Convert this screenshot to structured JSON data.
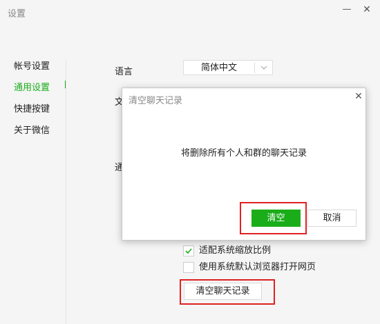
{
  "window": {
    "title": "设置",
    "minimize_glyph": "—",
    "close_glyph": "✕"
  },
  "sidebar": {
    "items": [
      {
        "label": "帐号设置",
        "active": false
      },
      {
        "label": "通用设置",
        "active": true
      },
      {
        "label": "快捷按键",
        "active": false
      },
      {
        "label": "关于微信",
        "active": false
      }
    ]
  },
  "general": {
    "language_label": "语言",
    "language_value": "简体中文",
    "file_label_partial": "文",
    "section_label_partial": "通",
    "options": [
      {
        "label": "适配系统缩放比例",
        "checked": true
      },
      {
        "label": "使用系统默认浏览器打开网页",
        "checked": false
      }
    ],
    "clear_history_button": "清空聊天记录"
  },
  "dialog": {
    "title": "清空聊天记录",
    "message": "将删除所有个人和群的聊天记录",
    "confirm": "清空",
    "cancel": "取消",
    "close_glyph": "✕"
  },
  "colors": {
    "accent": "#1aad19",
    "highlight": "#e02020",
    "background": "#f5f5f5"
  },
  "icons": [
    "minimize-icon",
    "close-icon",
    "dropdown-arrow-icon",
    "checkmark-icon"
  ]
}
